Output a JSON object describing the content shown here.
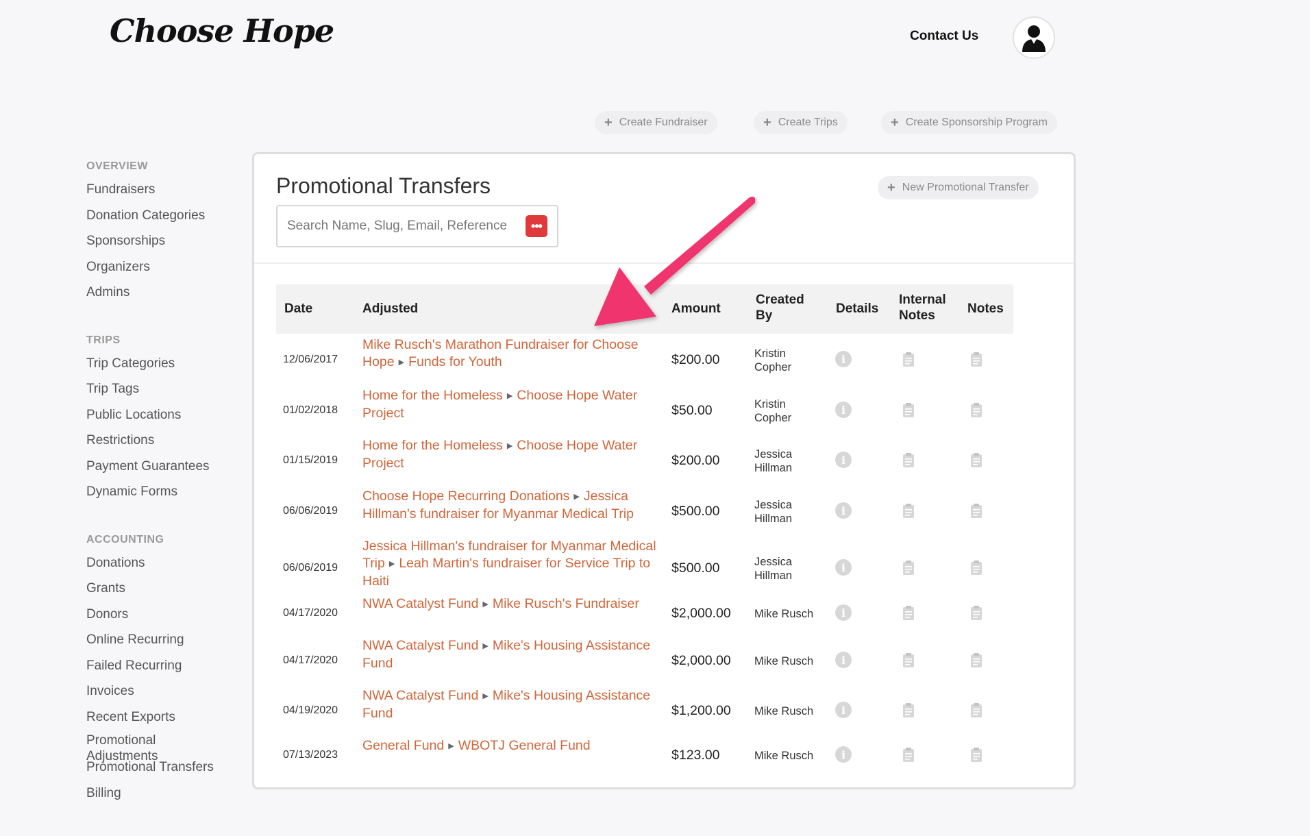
{
  "brand": {
    "logo_text": "Choose Hope"
  },
  "header": {
    "contact_label": "Contact Us",
    "avatar_icon": "user-avatar-icon"
  },
  "top_actions": [
    {
      "label": "Create Fundraiser",
      "icon": "plus-icon"
    },
    {
      "label": "Create Trips",
      "icon": "plus-icon"
    },
    {
      "label": "Create Sponsorship Program",
      "icon": "plus-icon"
    }
  ],
  "sidebar": {
    "overview": {
      "title": "OVERVIEW",
      "items": [
        "Fundraisers",
        "Donation Categories",
        "Sponsorships",
        "Organizers",
        "Admins"
      ]
    },
    "trips": {
      "title": "TRIPS",
      "items": [
        "Trip Categories",
        "Trip Tags",
        "Public Locations",
        "Restrictions",
        "Payment Guarantees",
        "Dynamic Forms"
      ]
    },
    "accounting": {
      "title": "ACCOUNTING",
      "items": [
        "Donations",
        "Grants",
        "Donors",
        "Online Recurring",
        "Failed Recurring",
        "Invoices",
        "Recent Exports",
        "Promotional Adjustments",
        "Promotional Transfers",
        "Billing"
      ]
    }
  },
  "main": {
    "title": "Promotional Transfers",
    "new_button_label": "New Promotional Transfer",
    "search_placeholder": "Search Name, Slug, Email, Reference",
    "columns": {
      "date": "Date",
      "adjusted": "Adjusted",
      "amount": "Amount",
      "created_by": "Created By",
      "details": "Details",
      "internal_notes": "Internal Notes",
      "notes": "Notes"
    },
    "rows": [
      {
        "date": "12/06/2017",
        "from": "Mike Rusch's Marathon Fundraiser for Choose Hope",
        "to": "Funds for Youth",
        "amount": "$200.00",
        "created_by": "Kristin Copher"
      },
      {
        "date": "01/02/2018",
        "from": "Home for the Homeless",
        "to": "Choose Hope Water Project",
        "amount": "$50.00",
        "created_by": "Kristin Copher"
      },
      {
        "date": "01/15/2019",
        "from": "Home for the Homeless",
        "to": "Choose Hope Water Project",
        "amount": "$200.00",
        "created_by": "Jessica Hillman"
      },
      {
        "date": "06/06/2019",
        "from": "Choose Hope Recurring Donations",
        "to": "Jessica Hillman's fundraiser for Myanmar Medical Trip",
        "amount": "$500.00",
        "created_by": "Jessica Hillman"
      },
      {
        "date": "06/06/2019",
        "from": "Jessica Hillman's fundraiser for Myanmar Medical Trip",
        "to": "Leah Martin's fundraiser for Service Trip to Haiti",
        "amount": "$500.00",
        "created_by": "Jessica Hillman"
      },
      {
        "date": "04/17/2020",
        "from": "NWA Catalyst Fund",
        "to": "Mike Rusch's Fundraiser",
        "amount": "$2,000.00",
        "created_by": "Mike Rusch"
      },
      {
        "date": "04/17/2020",
        "from": "NWA Catalyst Fund",
        "to": "Mike's Housing Assistance Fund",
        "amount": "$2,000.00",
        "created_by": "Mike Rusch"
      },
      {
        "date": "04/19/2020",
        "from": "NWA Catalyst Fund",
        "to": "Mike's Housing Assistance Fund",
        "amount": "$1,200.00",
        "created_by": "Mike Rusch"
      },
      {
        "date": "07/13/2023",
        "from": "General Fund",
        "to": "WBOTJ General Fund",
        "amount": "$123.00",
        "created_by": "Mike Rusch"
      }
    ]
  },
  "colors": {
    "link": "#d0663a",
    "annotation_arrow": "#f0366e",
    "search_badge": "#e0393b"
  }
}
